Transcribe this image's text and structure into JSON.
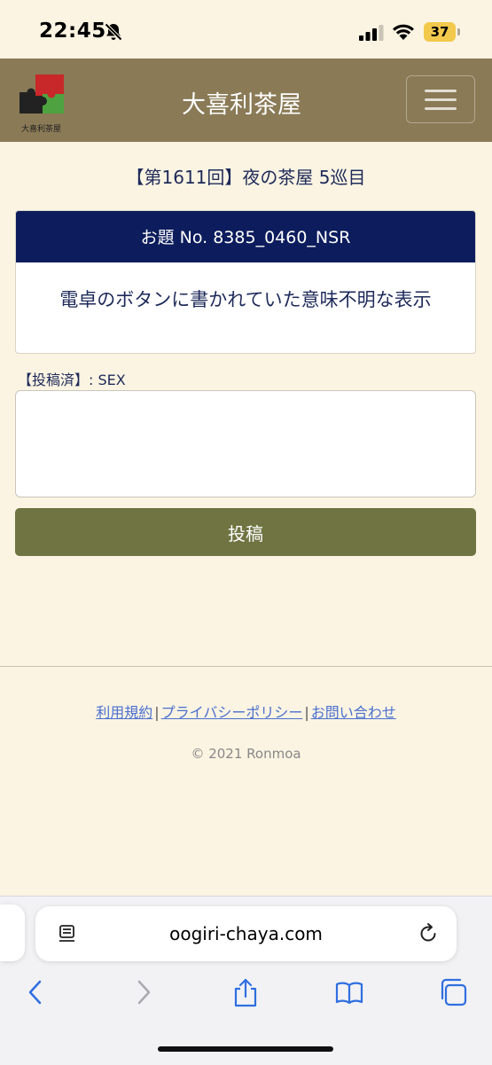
{
  "status_bar": {
    "time": "22:45",
    "battery": "37",
    "icons": [
      "bell-slash-icon",
      "signal-icon",
      "wifi-icon",
      "battery-icon"
    ]
  },
  "navbar": {
    "logo_text": "大喜利茶屋",
    "site_title": "大喜利茶屋",
    "menu_icon": "hamburger-icon"
  },
  "main": {
    "round_title": "【第1611回】夜の茶屋 5巡目",
    "topic_header": "お題 No. 8385_0460_NSR",
    "topic_text": "電卓のボタンに書かれていた意味不明な表示",
    "posted_label": "【投稿済】: SEX",
    "answer_value": "",
    "submit_label": "投稿"
  },
  "footer": {
    "links": [
      "利用規約",
      "プライバシーポリシー",
      "お問い合わせ"
    ],
    "separator": "|",
    "copyright": "© 2021 Ronmoa"
  },
  "browser": {
    "url": "oogiri-chaya.com",
    "toolbar_icons": [
      "back-icon",
      "forward-icon",
      "share-icon",
      "bookmarks-icon",
      "tabs-icon"
    ]
  },
  "colors": {
    "background": "#fbf4e2",
    "navbar": "#8a7a56",
    "topic_header": "#0c1c5c",
    "submit_button": "#6f7442",
    "link": "#4a6fd0"
  }
}
